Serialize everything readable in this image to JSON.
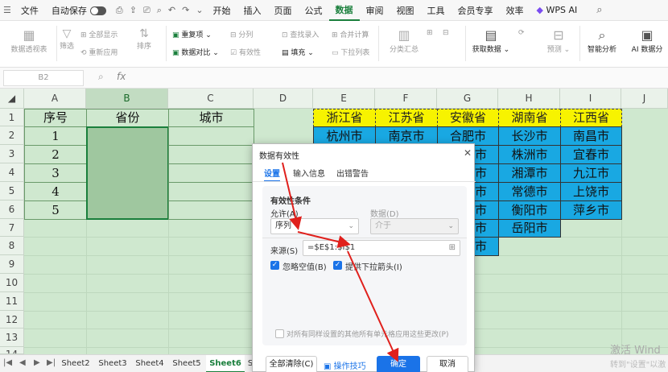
{
  "menubar": {
    "file": "文件",
    "autosave": "自动保存",
    "items": [
      "开始",
      "插入",
      "页面",
      "公式",
      "数据",
      "审阅",
      "视图",
      "工具",
      "会员专享",
      "效率"
    ],
    "active": "数据",
    "wps_ai": "WPS AI"
  },
  "ribbon": {
    "pivot": "数据透视表",
    "filter": "筛选",
    "show_all": "全部显示",
    "reapply": "重新应用",
    "sort": "排序",
    "duplicates": "重复项",
    "compare": "数据对比",
    "split": "分列",
    "validity": "有效性",
    "find_entry": "查找录入",
    "fill": "填充",
    "merge_calc": "合并计算",
    "dropdown_list": "下拉列表",
    "subtotal": "分类汇总",
    "get_data": "获取数据",
    "forecast": "预测",
    "smart_analysis": "智能分析",
    "ai_analysis": "AI 数据分"
  },
  "formula_bar": {
    "name_box": "B2",
    "fx": "fx"
  },
  "sheet": {
    "columns": [
      "A",
      "B",
      "C",
      "D",
      "E",
      "F",
      "G",
      "H",
      "I",
      "J"
    ],
    "rows": [
      "1",
      "2",
      "3",
      "4",
      "5",
      "6",
      "7",
      "8",
      "9",
      "10",
      "11",
      "12",
      "13",
      "14"
    ],
    "headers": {
      "a1": "序号",
      "b1": "省份",
      "c1": "城市"
    },
    "numbers": [
      "1",
      "2",
      "3",
      "4",
      "5"
    ],
    "provinces": [
      "浙江省",
      "江苏省",
      "安徽省",
      "湖南省",
      "江西省"
    ],
    "cities": [
      [
        "杭州市",
        "南京市",
        "合肥市",
        "长沙市",
        "南昌市"
      ],
      [
        "",
        "",
        "市",
        "株洲市",
        "宜春市"
      ],
      [
        "",
        "",
        "市",
        "湘潭市",
        "九江市"
      ],
      [
        "",
        "",
        "市",
        "常德市",
        "上饶市"
      ],
      [
        "",
        "",
        "市",
        "衡阳市",
        "萍乡市"
      ],
      [
        "",
        "",
        "市",
        "岳阳市",
        ""
      ],
      [
        "",
        "",
        "市",
        "",
        ""
      ]
    ]
  },
  "sheet_tabs": [
    "Sheet2",
    "Sheet3",
    "Sheet4",
    "Sheet5",
    "Sheet6",
    "S"
  ],
  "active_tab": "Sheet6",
  "dialog": {
    "title": "数据有效性",
    "tabs": [
      "设置",
      "输入信息",
      "出错警告"
    ],
    "section": "有效性条件",
    "allow_label": "允许(A)",
    "allow_value": "序列",
    "data_label": "数据(D)",
    "data_value": "介于",
    "source_label": "来源(S)",
    "source_value": "=$E$1:$I$1",
    "ignore_blank": "忽略空值(B)",
    "dropdown_arrow": "提供下拉箭头(I)",
    "apply_all": "对所有同样设置的其他所有单元格应用这些更改(P)",
    "clear_all": "全部清除(C)",
    "tips": "操作技巧",
    "ok": "确定",
    "cancel": "取消"
  },
  "watermark": {
    "line1": "激活 Wind",
    "line2": "转到\"设置\"以激"
  },
  "colors": {
    "accent": "#1a7f3c",
    "dialog_blue": "#1a73e8",
    "yellow": "#f7f300",
    "blue_cell": "#19a8e2",
    "sheet_bg": "#cfe8cf",
    "arrow": "#e0201c"
  }
}
